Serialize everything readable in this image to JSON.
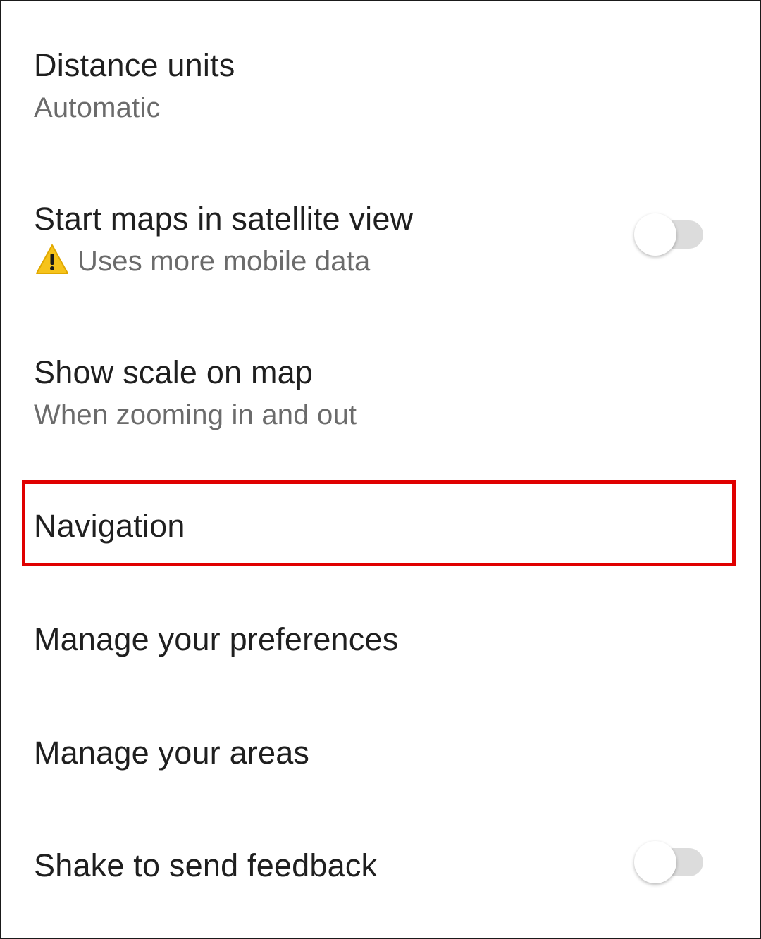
{
  "settings": {
    "distance_units": {
      "title": "Distance units",
      "value": "Automatic"
    },
    "satellite_view": {
      "title": "Start maps in satellite view",
      "note": "Uses more mobile data",
      "note_icon": "warning-icon",
      "enabled": false
    },
    "show_scale": {
      "title": "Show scale on map",
      "value": "When zooming in and out"
    },
    "navigation": {
      "title": "Navigation"
    },
    "manage_preferences": {
      "title": "Manage your preferences"
    },
    "manage_areas": {
      "title": "Manage your areas"
    },
    "shake_feedback": {
      "title": "Shake to send feedback",
      "enabled": false
    }
  },
  "colors": {
    "highlight": "#e00000",
    "title_text": "#1f1f1f",
    "subtitle_text": "#6b6b6b",
    "toggle_track": "#dcdcdc"
  }
}
